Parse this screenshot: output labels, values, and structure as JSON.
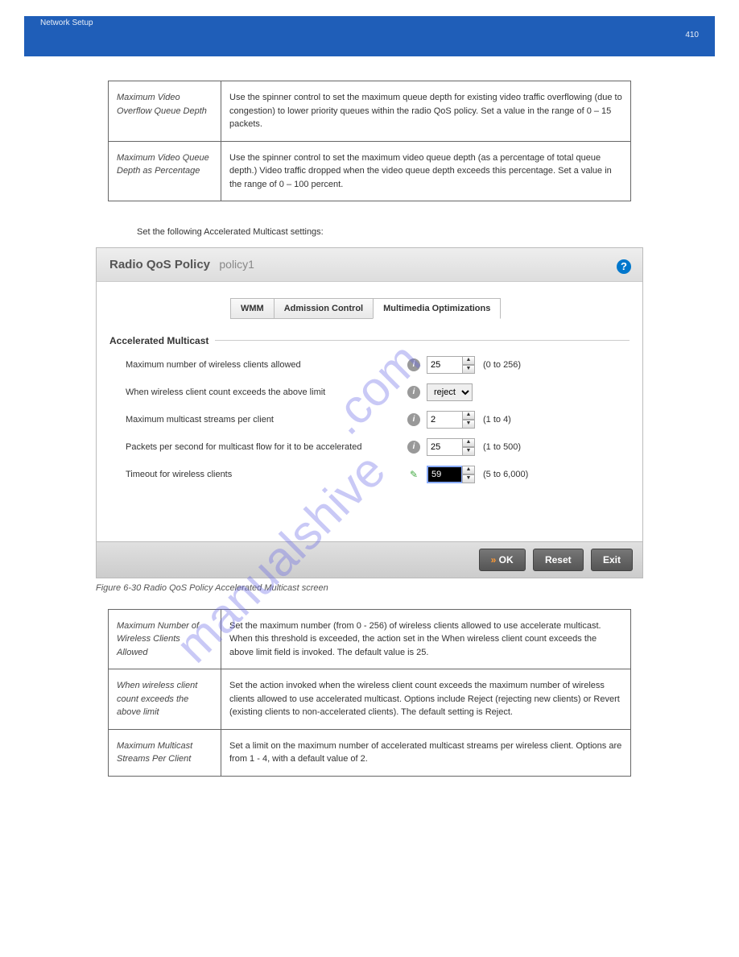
{
  "banner": {
    "left": "Network Setup",
    "right": "410"
  },
  "table1": {
    "rows": [
      {
        "label": "Maximum Video Overflow Queue Depth",
        "desc": "Use the spinner control to set the maximum queue depth for existing video traffic overflowing (due to congestion) to lower priority queues within the radio QoS policy. Set a value in the range of 0 – 15 packets."
      },
      {
        "label": "Maximum Video Queue Depth as Percentage",
        "desc": "Use the spinner control to set the maximum video queue depth (as a percentage of total queue depth.) Video traffic dropped when the video queue depth exceeds this percentage. Set a value in the range of 0 – 100 percent."
      }
    ]
  },
  "step14": "Set the following Accelerated Multicast settings:",
  "figureCaption": "Figure 6-30 Radio QoS Policy Accelerated Multicast screen",
  "panel": {
    "title": "Radio QoS Policy",
    "subtitle": "policy1",
    "tabs": [
      "WMM",
      "Admission Control",
      "Multimedia Optimizations"
    ],
    "section": "Accelerated Multicast",
    "rows": [
      {
        "label": "Maximum number of wireless clients allowed",
        "icon": "info",
        "value": "25",
        "hint": "(0 to 256)",
        "type": "spin"
      },
      {
        "label": "When wireless client count exceeds the above limit",
        "icon": "info",
        "value": "reject",
        "hint": "",
        "type": "select"
      },
      {
        "label": "Maximum multicast streams per client",
        "icon": "info",
        "value": "2",
        "hint": "(1 to 4)",
        "type": "spin"
      },
      {
        "label": "Packets per second for multicast flow for it to be accelerated",
        "icon": "info",
        "value": "25",
        "hint": "(1 to 500)",
        "type": "spin"
      },
      {
        "label": "Timeout for wireless clients",
        "icon": "edit",
        "value": "59",
        "hint": "(5 to 6,000)",
        "type": "spin-hl"
      }
    ],
    "buttons": {
      "ok": "OK",
      "reset": "Reset",
      "exit": "Exit"
    }
  },
  "table2": {
    "rows": [
      {
        "label": "Maximum Number of Wireless Clients Allowed",
        "desc": "Set the maximum number (from 0 - 256) of wireless clients allowed to use accelerate multicast. When this threshold is exceeded, the action set in the When wireless client count exceeds the above limit field is invoked. The default value is 25."
      },
      {
        "label": "When wireless client count exceeds the above limit",
        "desc": "Set the action invoked when the wireless client count exceeds the maximum number of wireless clients allowed to use accelerated multicast. Options include Reject (rejecting new clients) or Revert (existing clients to non-accelerated clients). The default setting is Reject."
      },
      {
        "label": "Maximum Multicast Streams Per Client",
        "desc": "Set a limit on the maximum number of accelerated multicast streams per wireless client. Options are from 1 - 4, with a default value of 2."
      }
    ]
  },
  "watermark": "manualshive.com"
}
